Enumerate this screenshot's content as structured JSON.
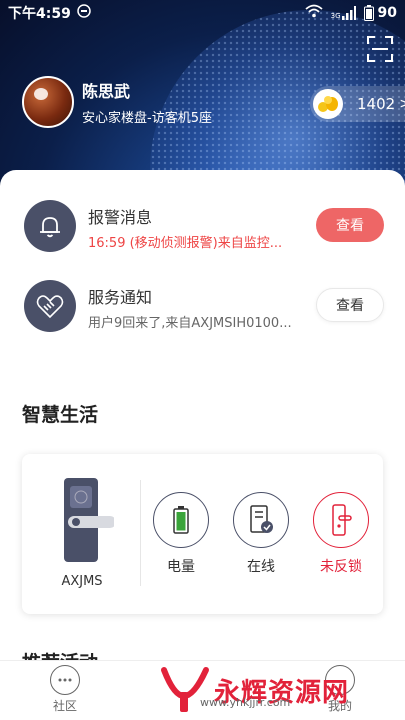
{
  "status_bar": {
    "time": "下午4:59",
    "network": "3G",
    "battery": "90"
  },
  "user": {
    "name": "陈思武",
    "subtitle": "安心家楼盘-访客机5座",
    "points": "1402",
    "arrow": ">"
  },
  "messages": [
    {
      "title": "报警消息",
      "text": "16:59 (移动侦测报警)来自监控...",
      "button": "查看",
      "text_color": "#ee4444"
    },
    {
      "title": "服务通知",
      "text": "用户9回来了,来自AXJMSIH0100...",
      "button": "查看",
      "text_color": "#666666"
    }
  ],
  "smart_life": {
    "title": "智慧生活",
    "device_name": "AXJMS",
    "stats": [
      {
        "label": "电量",
        "icon": "battery-icon",
        "color": "#333333"
      },
      {
        "label": "在线",
        "icon": "server-online-icon",
        "color": "#333333"
      },
      {
        "label": "未反锁",
        "icon": "door-lock-icon",
        "color": "#e2223a"
      }
    ]
  },
  "recommend": {
    "title": "推荐活动"
  },
  "bottom_nav": {
    "tabs": [
      {
        "label": "社区",
        "icon": "chat-bubble-icon"
      },
      {
        "label": "我的",
        "icon": "profile-icon"
      }
    ]
  },
  "watermark": {
    "text": "永辉资源网",
    "url": "www.yhkjjrr.com"
  },
  "colors": {
    "accent_red": "#ee6666",
    "icon_dark": "#4a5068",
    "hero_bg": "#0b1f4a"
  }
}
